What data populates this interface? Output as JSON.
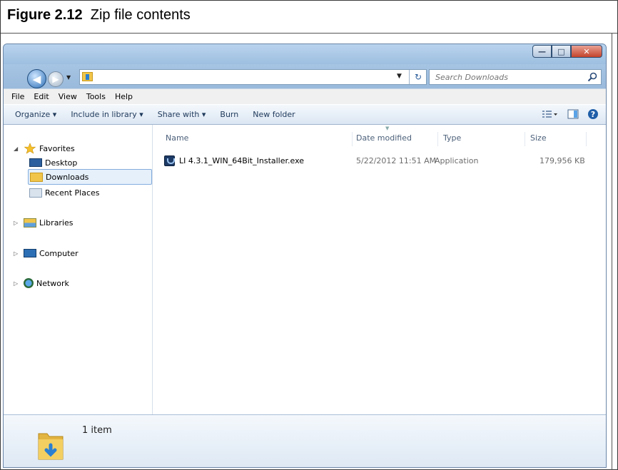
{
  "figure": {
    "number": "Figure 2.12",
    "caption": "Zip file contents"
  },
  "window": {
    "controls": [
      "minimize",
      "maximize",
      "close"
    ],
    "search": {
      "placeholder": "Search Downloads"
    }
  },
  "menu": {
    "items": [
      "File",
      "Edit",
      "View",
      "Tools",
      "Help"
    ]
  },
  "toolbar": {
    "organize": "Organize ▾",
    "include": "Include in library ▾",
    "share": "Share with ▾",
    "burn": "Burn",
    "new_folder": "New folder"
  },
  "nav": {
    "favorites": "Favorites",
    "desktop": "Desktop",
    "downloads": "Downloads",
    "recent": "Recent Places",
    "libraries": "Libraries",
    "computer": "Computer",
    "network": "Network"
  },
  "columns": {
    "name": "Name",
    "date": "Date modified",
    "type": "Type",
    "size": "Size"
  },
  "files": [
    {
      "name": "LI 4.3.1_WIN_64Bit_Installer.exe",
      "date": "5/22/2012 11:51 AM",
      "type": "Application",
      "size": "179,956 KB"
    }
  ],
  "status": {
    "count": "1 item"
  },
  "colors": {
    "window_frame": "#8fb1d5",
    "selection": "#e5f0fb",
    "close_button": "#c4432b"
  }
}
